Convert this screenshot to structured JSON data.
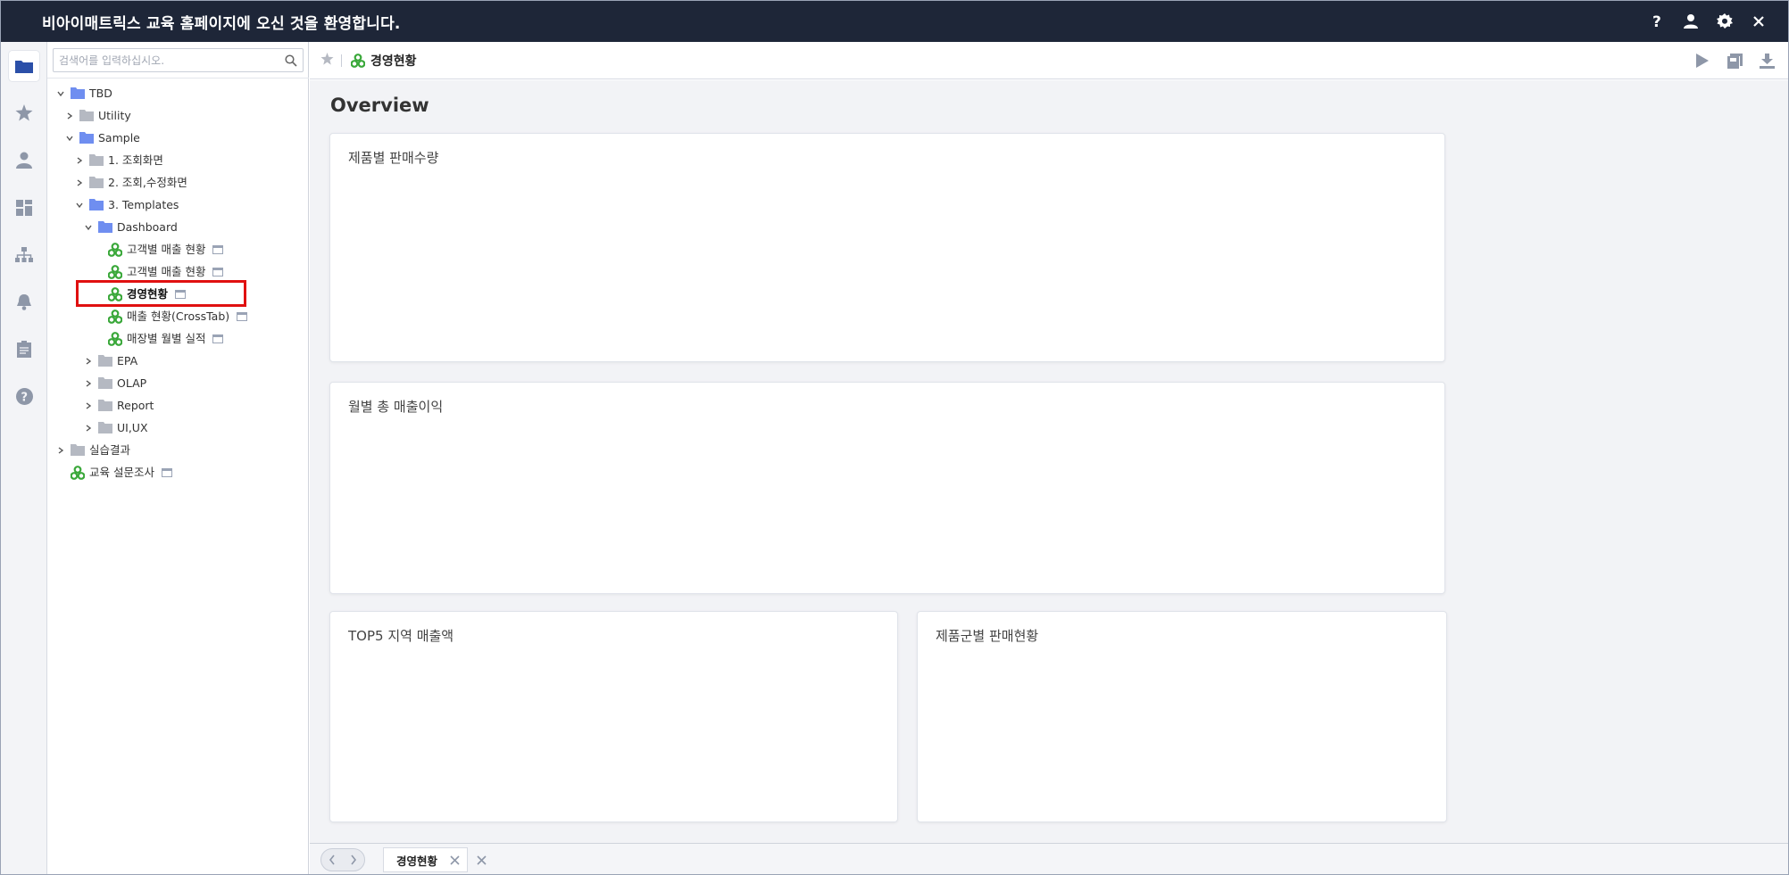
{
  "app": {
    "title": "비아이매트릭스 교육 홈페이지에 오신 것을 환영합니다."
  },
  "search": {
    "placeholder": "검색어를 입력하십시오."
  },
  "tree": {
    "items": [
      {
        "label": "TBD"
      },
      {
        "label": "Utility"
      },
      {
        "label": "Sample"
      },
      {
        "label": "1. 조회화면"
      },
      {
        "label": "2. 조회,수정화면"
      },
      {
        "label": "3. Templates"
      },
      {
        "label": "Dashboard"
      },
      {
        "label": "고객별 매출 현황"
      },
      {
        "label": "고객별 매출 현황"
      },
      {
        "label": "경영현황"
      },
      {
        "label": "매출 현황(CrossTab)"
      },
      {
        "label": "매장별 월별 실적"
      },
      {
        "label": "EPA"
      },
      {
        "label": "OLAP"
      },
      {
        "label": "Report"
      },
      {
        "label": "UI,UX"
      },
      {
        "label": "실습결과"
      },
      {
        "label": "교육 설문조사"
      }
    ]
  },
  "header": {
    "page_title": "경영현황"
  },
  "content": {
    "heading": "Overview",
    "cards": [
      {
        "title": "제품별 판매수량"
      },
      {
        "title": "월별 총 매출이익"
      },
      {
        "title": "TOP5 지역 매출액"
      },
      {
        "title": "제품군별 판매현황"
      }
    ]
  },
  "tabs": [
    {
      "label": "경영현황"
    }
  ],
  "colors": {
    "titlebar": "#1e2638",
    "folder_open": "#6f8ef0",
    "folder_closed": "#b5b9c2",
    "dashboard_icon": "#3aa83a",
    "highlight": "#e01010"
  }
}
